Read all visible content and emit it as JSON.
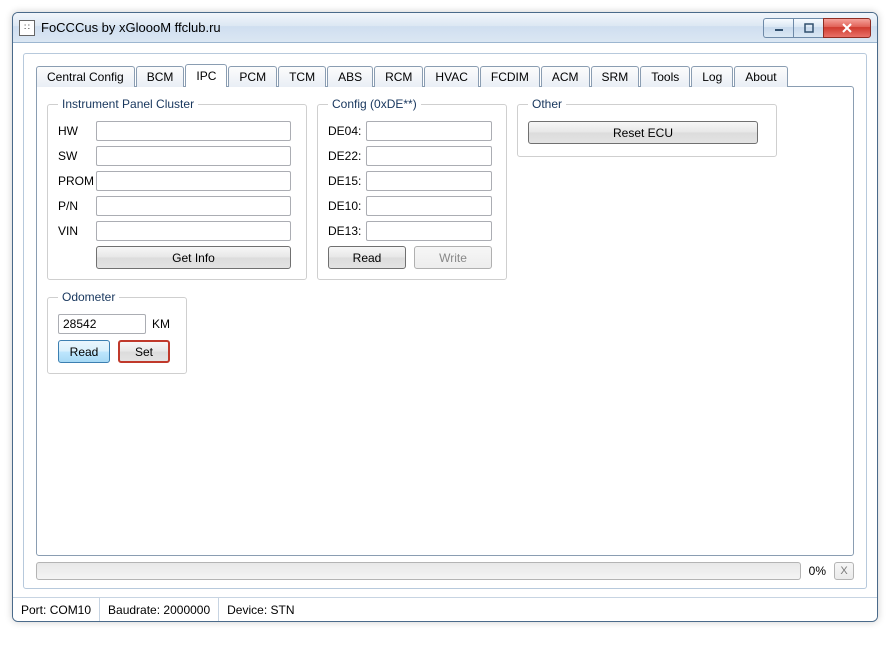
{
  "window": {
    "title": "FoCCCus by xGloooM ffclub.ru"
  },
  "tabs": [
    "Central Config",
    "BCM",
    "IPC",
    "PCM",
    "TCM",
    "ABS",
    "RCM",
    "HVAC",
    "FCDIM",
    "ACM",
    "SRM",
    "Tools",
    "Log",
    "About"
  ],
  "active_tab": "IPC",
  "ipc": {
    "legend": "Instrument Panel Cluster",
    "hw_label": "HW",
    "hw": "",
    "sw_label": "SW",
    "sw": "",
    "prom_label": "PROM",
    "prom": "",
    "pn_label": "P/N",
    "pn": "",
    "vin_label": "VIN",
    "vin": "",
    "get_info": "Get Info"
  },
  "config": {
    "legend": "Config (0xDE**)",
    "de04_label": "DE04:",
    "de04": "",
    "de22_label": "DE22:",
    "de22": "",
    "de15_label": "DE15:",
    "de15": "",
    "de10_label": "DE10:",
    "de10": "",
    "de13_label": "DE13:",
    "de13": "",
    "read": "Read",
    "write": "Write"
  },
  "other": {
    "legend": "Other",
    "reset": "Reset ECU"
  },
  "odometer": {
    "legend": "Odometer",
    "value": "28542",
    "unit": "KM",
    "read": "Read",
    "set": "Set"
  },
  "progress": {
    "percent": "0%",
    "cancel": "X"
  },
  "status": {
    "port_label": "Port:",
    "port": "COM10",
    "baud_label": "Baudrate:",
    "baud": "2000000",
    "dev_label": "Device:",
    "dev": "STN"
  }
}
